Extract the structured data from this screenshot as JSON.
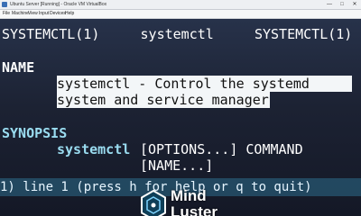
{
  "window": {
    "title": "Ubuntu Server [Running] - Oracle VM VirtualBox",
    "controls": [
      "—",
      "□",
      "✕"
    ]
  },
  "menubar": {
    "items": [
      "File",
      "Machine",
      "View",
      "Input",
      "Devices",
      "Help"
    ]
  },
  "terminal": {
    "header": "SYSTEMCTL(1)     systemctl     SYSTEMCTL(1)",
    "section_name": "NAME",
    "name_line1": "systemctl - Control the systemd",
    "name_line2": "system and service manager",
    "section_synopsis": "SYNOPSIS",
    "synopsis_cmd": "systemctl",
    "synopsis_args": "[OPTIONS...] COMMAND",
    "synopsis_args2": "[NAME...]",
    "status_line": "1) line 1 (press h for help or q to quit)"
  },
  "watermark": {
    "brand_line1": "Mind",
    "brand_line2": "Luster",
    "icon": "hexagon-logo-icon"
  },
  "colors": {
    "terminal_bg": "#1c2233",
    "highlight_bg": "#f3f6f8",
    "status_band": "#2d6e8c"
  }
}
